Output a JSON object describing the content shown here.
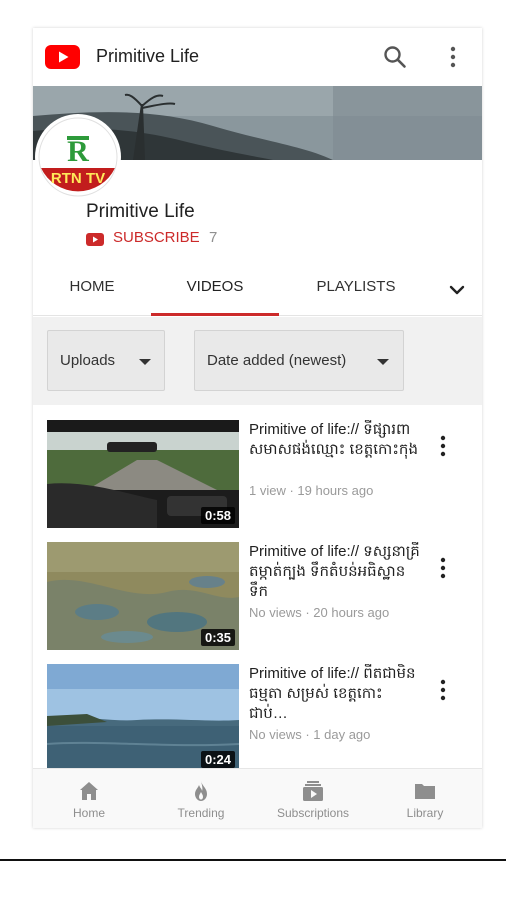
{
  "app": {
    "title": "Primitive Life",
    "brand_color": "#ff0000"
  },
  "channel": {
    "avatar_text": "RTN TV",
    "avatar_letter": "R",
    "name": "Primitive Life",
    "subscribe_label": "SUBSCRIBE",
    "subscriber_count": "7"
  },
  "tabs": [
    {
      "label": "HOME",
      "active": false
    },
    {
      "label": "VIDEOS",
      "active": true
    },
    {
      "label": "PLAYLISTS",
      "active": false
    }
  ],
  "filters": {
    "uploads_label": "Uploads",
    "sort_label": "Date added (newest)"
  },
  "videos": [
    {
      "title": "Primitive of life:// ទីផ្សារពាសមាសផង់ឈ្មោះ ខេត្តកោះកុង",
      "meta": "1 view · 19 hours ago",
      "duration": "0:58"
    },
    {
      "title": "Primitive of life:// ទស្សនាគ្រីតម្កាត់ក្បង ទឹកតំបន់អធិស្ឋានទឹក",
      "meta": "No views · 20 hours ago",
      "duration": "0:35"
    },
    {
      "title": "Primitive of life:// ពីតជាមិនធម្មតា សម្រស់ ខេត្តកោះជាប់…",
      "meta": "No views · 1 day ago",
      "duration": "0:24"
    }
  ],
  "bottom_nav": [
    {
      "label": "Home",
      "icon": "home-icon"
    },
    {
      "label": "Trending",
      "icon": "trending-icon"
    },
    {
      "label": "Subscriptions",
      "icon": "subscriptions-icon"
    },
    {
      "label": "Library",
      "icon": "library-icon"
    }
  ],
  "colors": {
    "accent": "#cc2a2a",
    "nav_icon": "#8e8e8e"
  }
}
